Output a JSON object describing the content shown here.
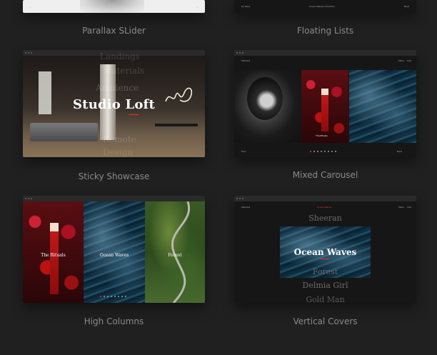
{
  "captions": {
    "parallax": "Parallax SLider",
    "floating": "Floating Lists",
    "sticky": "Sticky Showcase",
    "mixed": "Mixed Carousel",
    "high": "High Columns",
    "vertical": "Vertical Covers"
  },
  "sticky": {
    "title": "Studio Loft",
    "ghost_words": [
      "Landings",
      "Materials",
      "Ambience",
      "Remote",
      "Design"
    ]
  },
  "mixed": {
    "brand": "Manfest",
    "nav_items": [
      "Menu",
      "Cart"
    ],
    "slide_label": "The Rituals",
    "footer_left": "Prev",
    "footer_right": "Next"
  },
  "high": {
    "columns": [
      "The Rituals",
      "Ocean Waves",
      "Forest"
    ]
  },
  "vertical": {
    "brand": "Manfest",
    "header_center": "Ocean Waves",
    "nav_items": [
      "Menu",
      "Cart"
    ],
    "list": [
      "Sheeran",
      "Ocean Waves",
      "Forest",
      "Delmia Girl",
      "Gold Man"
    ],
    "active_index": 1
  },
  "floating": {
    "left": "Go Back",
    "center": "Ocean Waves Collection",
    "right": "Next"
  },
  "colors": {
    "background": "#202020",
    "accent": "#e33333",
    "caption": "#8a8a8a"
  }
}
